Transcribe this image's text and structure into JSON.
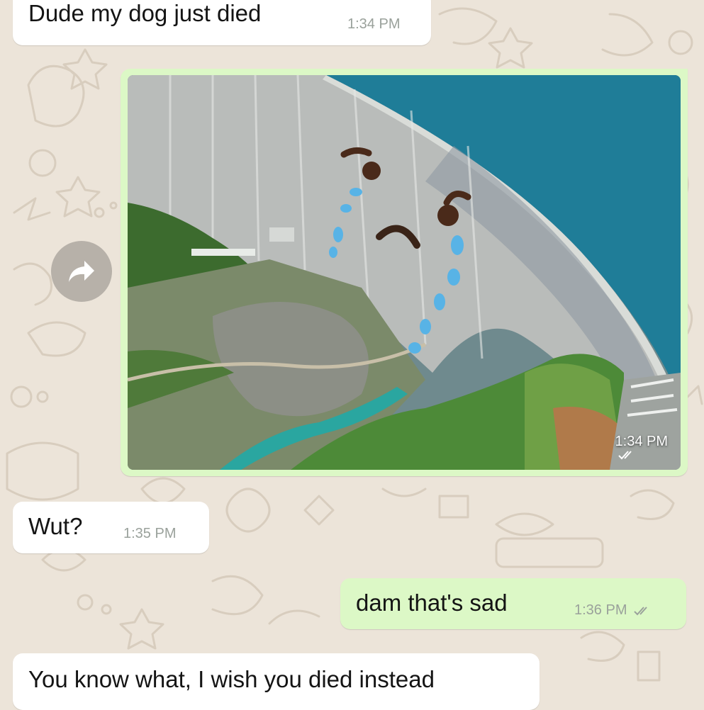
{
  "colors": {
    "wallpaper": "#ece4d9",
    "incoming_bubble": "#ffffff",
    "outgoing_bubble": "#dcf8c6",
    "timestamp": "#9aa19b"
  },
  "messages": [
    {
      "direction": "incoming",
      "text": "Dude my dog just died",
      "time": "1:34 PM"
    },
    {
      "direction": "outgoing",
      "type": "image",
      "image_description": "aerial photo of a concrete dam with a drawn-on crying face",
      "time": "1:34 PM",
      "status_icon": "double-check-icon"
    },
    {
      "direction": "incoming",
      "text": "Wut?",
      "time": "1:35 PM"
    },
    {
      "direction": "outgoing",
      "text": "dam that's sad",
      "time": "1:36 PM",
      "status_icon": "double-check-icon"
    },
    {
      "direction": "incoming",
      "text": "You know what, I wish you died instead"
    }
  ],
  "forward_button": {
    "icon": "forward-arrow-icon"
  }
}
